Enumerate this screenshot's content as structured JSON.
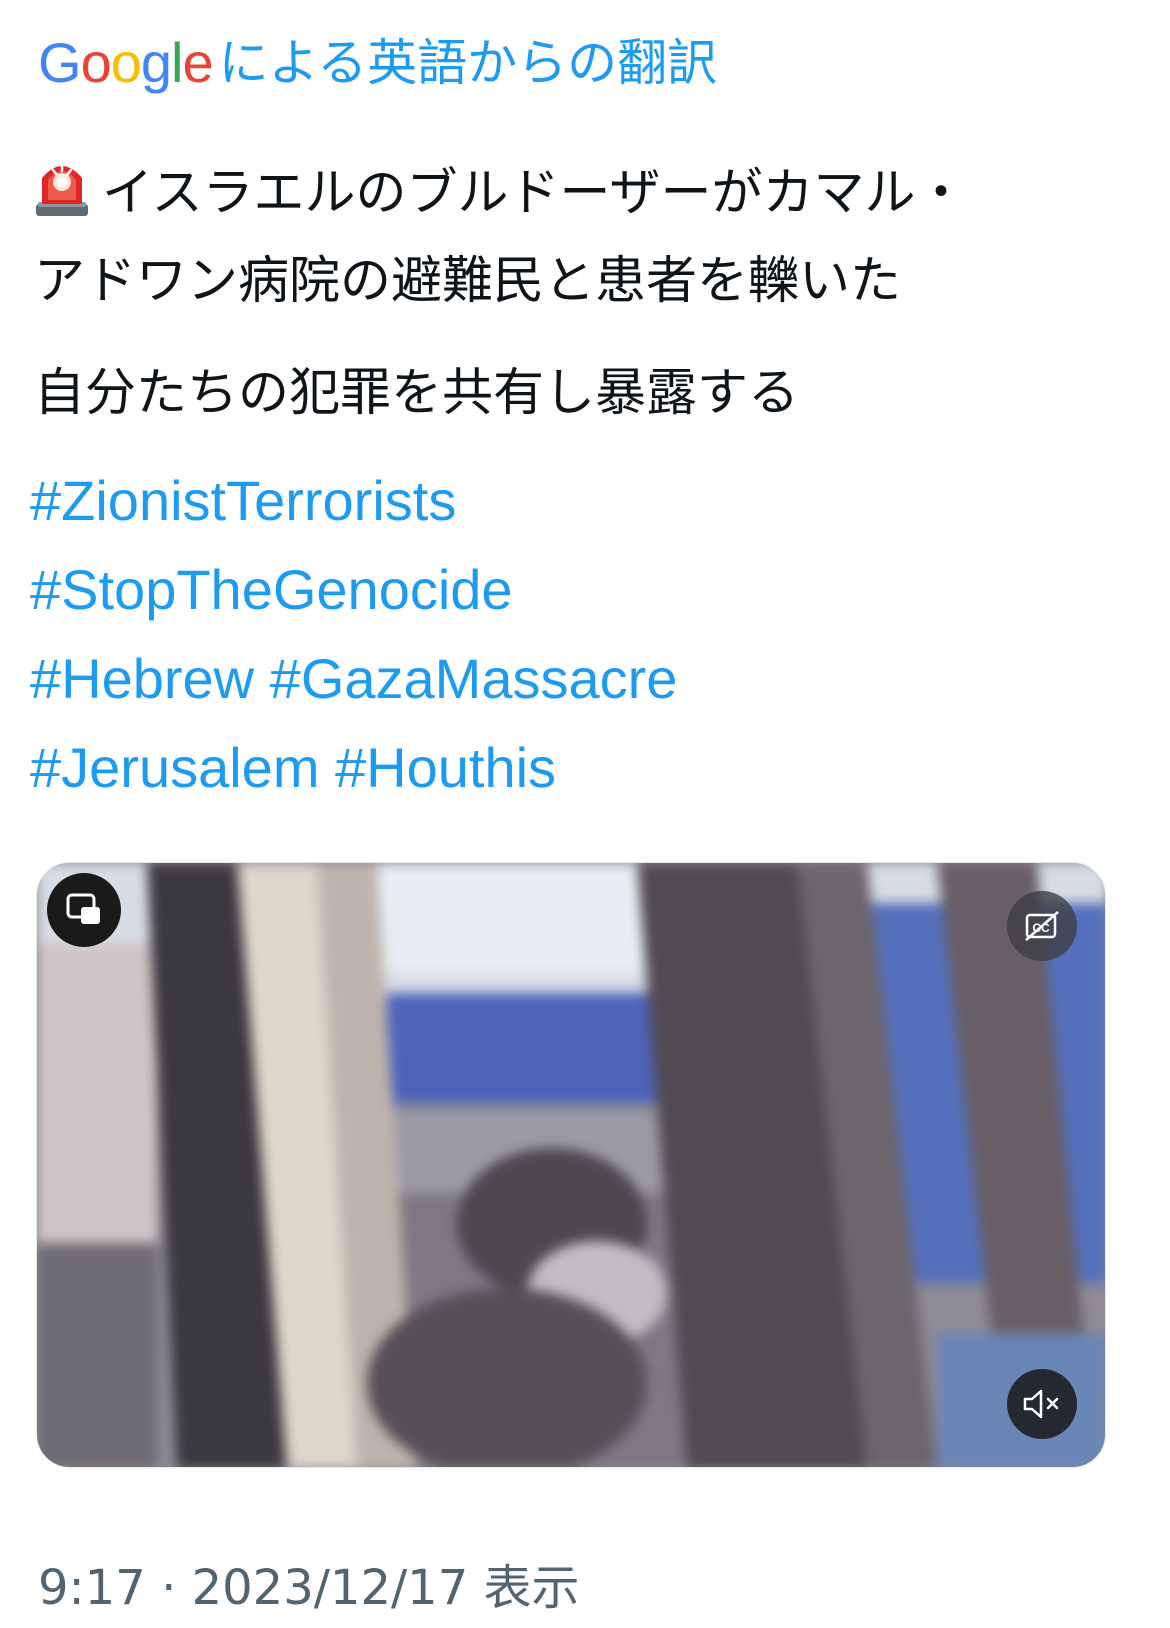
{
  "translation": {
    "google_letters": [
      {
        "ch": "G",
        "color": "#4285f4"
      },
      {
        "ch": "o",
        "color": "#ea4335"
      },
      {
        "ch": "o",
        "color": "#fbbc05"
      },
      {
        "ch": "g",
        "color": "#4285f4"
      },
      {
        "ch": "l",
        "color": "#34a853"
      },
      {
        "ch": "e",
        "color": "#ea4335"
      }
    ],
    "label": "による英語からの翻訳",
    "link_color": "#1d9bf0"
  },
  "tweet": {
    "emoji": "rotating-light-icon",
    "line1": "イスラエルのブルドーザーがカマル・",
    "line2": "アドワン病院の避難民と患者を轢いた",
    "line3": "自分たちの犯罪を共有し暴露する",
    "hashtags": [
      [
        "#ZionistTerrorists"
      ],
      [
        "#StopTheGenocide"
      ],
      [
        "#Hebrew",
        "#GazaMassacre"
      ],
      [
        "#Jerusalem",
        "#Houthis"
      ]
    ]
  },
  "video": {
    "pip_icon": "picture-in-picture-icon",
    "captions_icon": "captions-off-icon",
    "mute_icon": "volume-muted-icon"
  },
  "meta": {
    "time": "9:17",
    "date": "2023/12/17",
    "views_label": "表示"
  }
}
